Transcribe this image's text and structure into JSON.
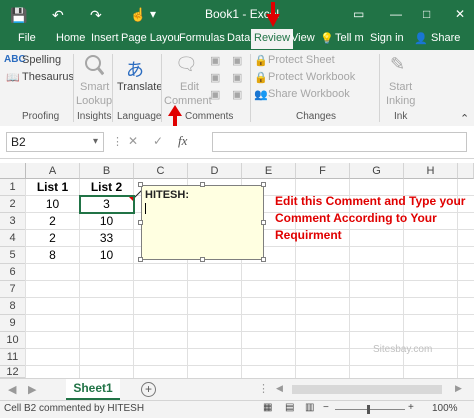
{
  "titlebar": {
    "title": "Book1 - Excel",
    "minimize": "—",
    "maximize": "□",
    "close": "✕"
  },
  "tabs": {
    "file": "File",
    "home": "Home",
    "insert": "Insert",
    "page_layout": "Page Layou",
    "formulas": "Formulas",
    "data": "Data",
    "review": "Review",
    "view": "View",
    "tell_me": "Tell m",
    "sign_in": "Sign in",
    "share": "Share"
  },
  "ribbon": {
    "spelling": "Spelling",
    "thesaurus": "Thesaurus",
    "proofing": "Proofing",
    "smart_lookup_1": "Smart",
    "smart_lookup_2": "Lookup",
    "insights": "Insights",
    "translate": "Translate",
    "language": "Language",
    "edit_comment_1": "Edit",
    "edit_comment_2": "Comment",
    "comments": "Comments",
    "protect_sheet": "Protect Sheet",
    "protect_workbook": "Protect Workbook",
    "share_workbook": "Share Workbook",
    "changes": "Changes",
    "start_inking_1": "Start",
    "start_inking_2": "Inking",
    "ink": "Ink"
  },
  "formula": {
    "name_box": "B2",
    "cancel": "✕",
    "enter": "✓",
    "fx": "fx",
    "value": ""
  },
  "columns": [
    "A",
    "B",
    "C",
    "D",
    "E",
    "F",
    "G",
    "H"
  ],
  "rows": [
    "1",
    "2",
    "3",
    "4",
    "5",
    "6",
    "7",
    "8",
    "9",
    "10",
    "11",
    "12"
  ],
  "cells": {
    "a1": "List 1",
    "b1": "List 2",
    "a2": "10",
    "b2": "3",
    "a3": "2",
    "b3": "10",
    "a4": "2",
    "b4": "33",
    "a5": "8",
    "b5": "10"
  },
  "comment": {
    "author": "HITESH:"
  },
  "annotation": "Edit this Comment and Type your Comment According to Your Requirment",
  "watermark": "Sitesbay.com",
  "sheet": {
    "name": "Sheet1",
    "add": "+"
  },
  "status": {
    "text": "Cell B2 commented by HITESH",
    "zoom": "100%"
  },
  "colors": {
    "excel_green": "#217346",
    "arrow_red": "#e00000",
    "comment_bg": "#ffffe1"
  }
}
